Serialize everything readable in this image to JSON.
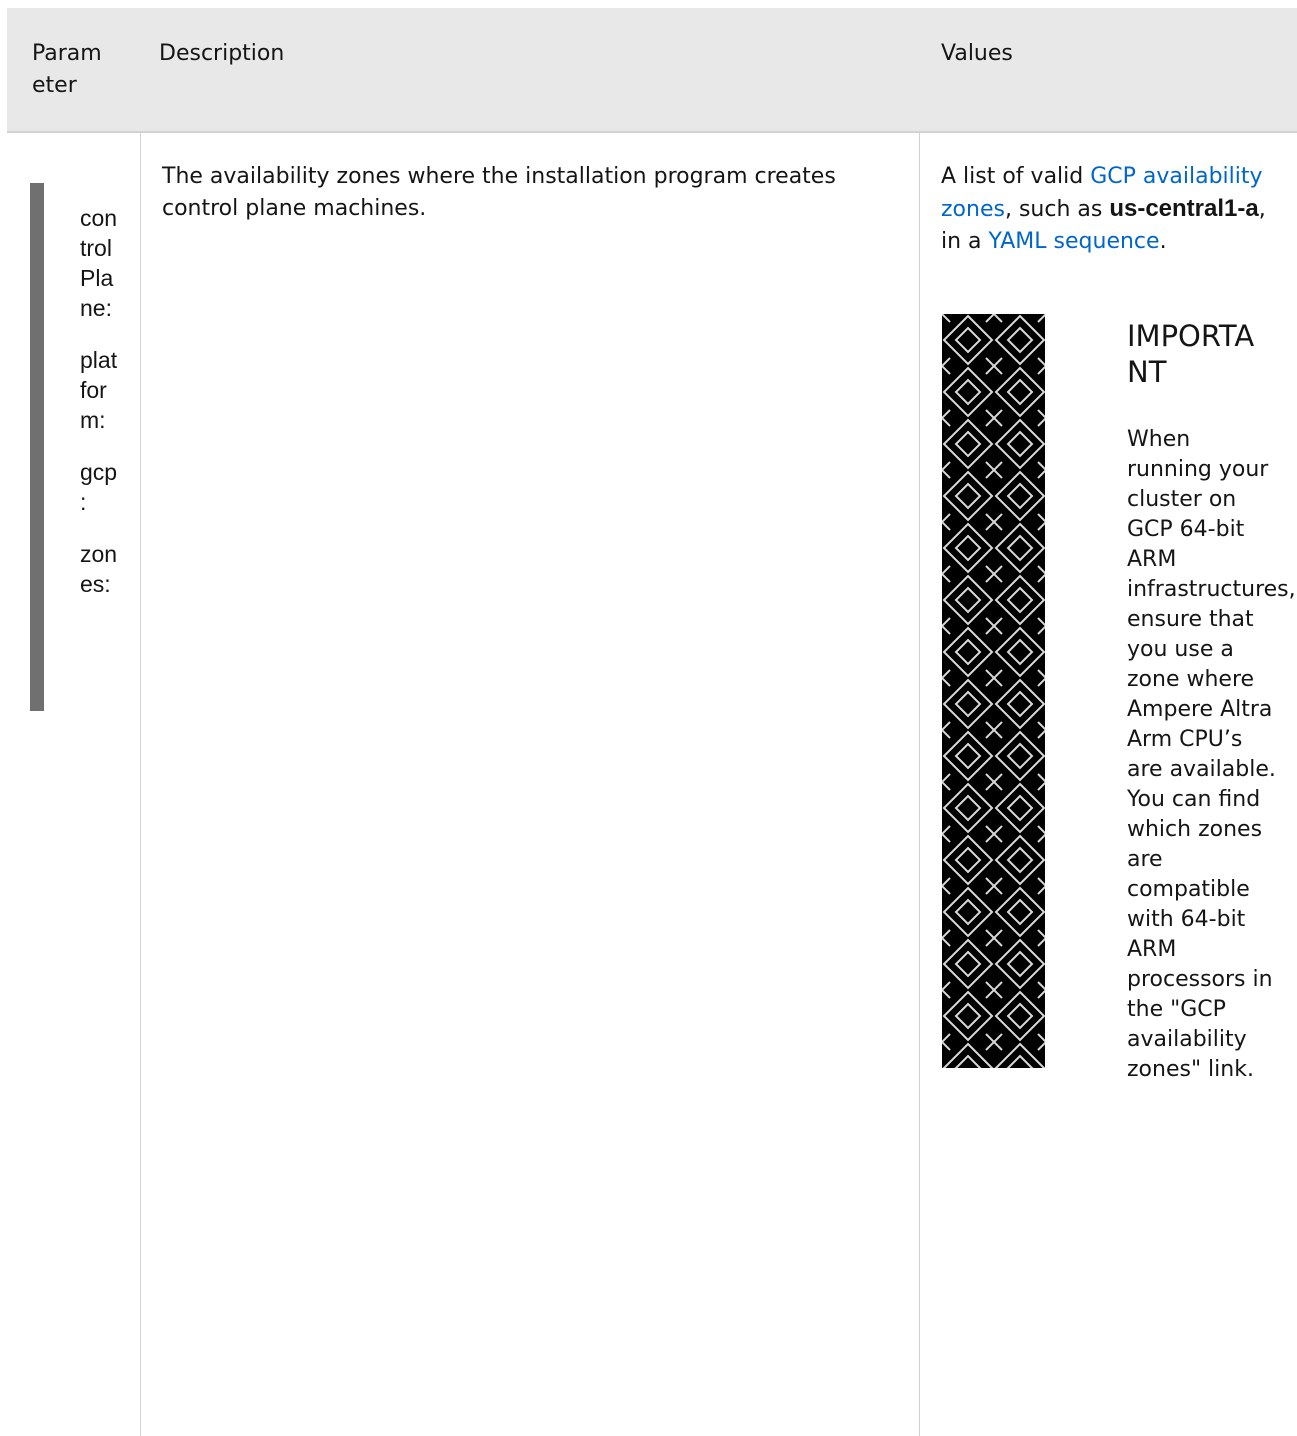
{
  "table": {
    "headers": {
      "parameter": "Param eter",
      "description": "Description",
      "values": "Values"
    },
    "row": {
      "parameter_lines": [
        [
          "con",
          "trol",
          "Pla",
          "ne:"
        ],
        [
          "plat",
          "for",
          "m:"
        ],
        [
          "gcp",
          ":"
        ],
        [
          "zon",
          "es:"
        ]
      ],
      "description": "The availability zones where the installation program creates control plane machines.",
      "values": {
        "prefix": "A list of valid ",
        "link_zones": "GCP availability zones",
        "middle": ", such as ",
        "example": "us-central1-a",
        "after_example": ", in a ",
        "link_yaml": "YAML sequence",
        "suffix": "."
      },
      "admonition": {
        "title": "IMPORTA NT",
        "body": "When running your cluster on GCP 64-bit ARM infrastructures, ensure that you use a zone where Ampere Altra Arm CPU’s are available. You can find which zones are compatible with 64-bit ARM processors in the \"GCP availability zones\" link."
      }
    }
  },
  "colors": {
    "header_bg": "#e8e8e8",
    "link": "#0066cc",
    "bar": "#707070",
    "icon_bg": "#000000"
  }
}
